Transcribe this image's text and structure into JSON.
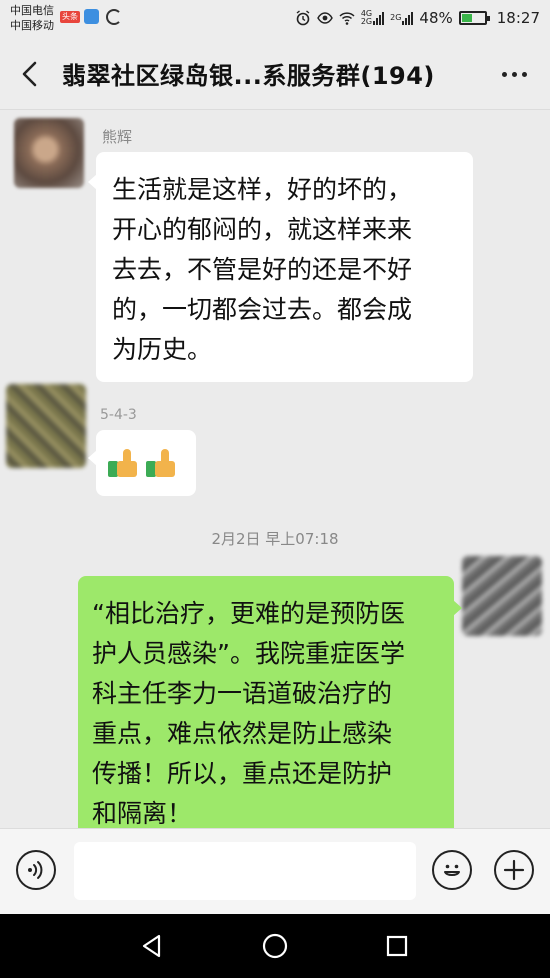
{
  "status_bar": {
    "carrier1": "中国电信",
    "carrier2": "中国移动",
    "app_badge": "头条",
    "net_tag_a": "4G",
    "net_tag_b": "2G",
    "battery": "48%",
    "battery_level": 0.48,
    "time": "18:27"
  },
  "header": {
    "title": "翡翠社区绿岛银...系服务群(194)"
  },
  "messages": [
    {
      "sender": "熊辉",
      "direction": "in",
      "lines": [
        "生活就是这样，好的坏的，",
        "开心的郁闷的，就这样来来",
        "去去，不管是好的还是不好",
        "的，一切都会过去。都会成",
        "为历史。"
      ]
    },
    {
      "sender": "5-4-3",
      "direction": "in",
      "icons": [
        "thumbs-up-icon",
        "thumbs-up-icon"
      ]
    },
    {
      "direction": "out",
      "lines": [
        "“相比治疗，更难的是预防医",
        "护人员感染”。我院重症医学",
        "科主任李力一语道破治疗的",
        "重点，难点依然是防止感染",
        "传播！所以，重点还是防护",
        "和隔离！"
      ]
    }
  ],
  "timestamp": "2月2日 早上07:18",
  "input": {
    "value": "",
    "placeholder": ""
  },
  "colors": {
    "out_bubble": "#9de86a",
    "in_bubble": "#ffffff",
    "background": "#ebebeb"
  }
}
